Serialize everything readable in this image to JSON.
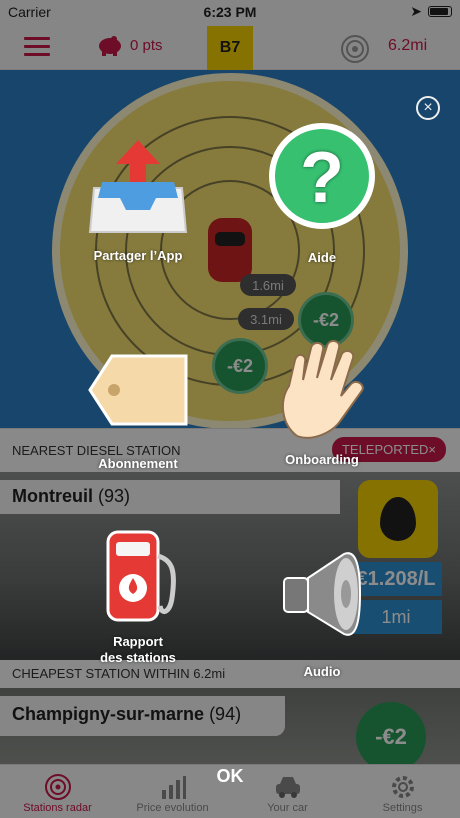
{
  "status": {
    "carrier": "Carrier",
    "time": "6:23 PM"
  },
  "topbar": {
    "points": "0 pts",
    "fuel_type": "B7",
    "range": "6.2mi"
  },
  "radar": {
    "distance_labels": [
      "1.6mi",
      "3.1mi"
    ],
    "price_badges": [
      "-€2",
      "-€2"
    ]
  },
  "nearest": {
    "title": "NEAREST DIESEL STATION",
    "teleported": "TELEPORTED×",
    "name": "Montreuil",
    "count": "(93)",
    "price": "€1.208/L",
    "distance": "1mi"
  },
  "cheapest": {
    "title": "CHEAPEST STATION WITHIN 6.2mi",
    "name": "Champigny-sur-marne",
    "count": "(94)",
    "badge": "-€2"
  },
  "tabs": [
    {
      "label": "Stations radar"
    },
    {
      "label": "Price evolution"
    },
    {
      "label": "Your car"
    },
    {
      "label": "Settings"
    }
  ],
  "menu": {
    "share": "Partager l’App",
    "help": "Aide",
    "subscription": "Abonnement",
    "onboarding": "Onboarding",
    "report": "Rapport\ndes stations",
    "audio": "Audio",
    "ok": "OK"
  },
  "colors": {
    "accent": "#c8184a",
    "fuel": "#f5d000",
    "radar_bg": "#2b7fc4",
    "green": "#279a56"
  }
}
